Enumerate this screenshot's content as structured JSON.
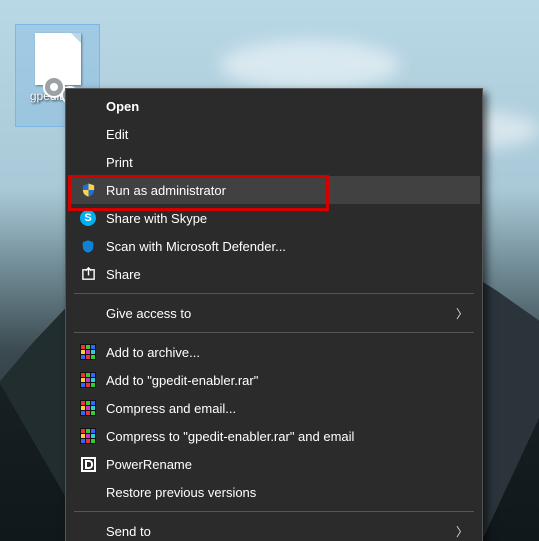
{
  "desktop": {
    "icon": {
      "label": "gpedit-e…",
      "name": "gpedit-enabler"
    }
  },
  "context_menu": {
    "open": "Open",
    "edit": "Edit",
    "print": "Print",
    "run_admin": "Run as administrator",
    "skype": "Share with Skype",
    "defender": "Scan with Microsoft Defender...",
    "share": "Share",
    "give_access": "Give access to",
    "add_archive": "Add to archive...",
    "add_named": "Add to \"gpedit-enabler.rar\"",
    "compress_email": "Compress and email...",
    "compress_named_email": "Compress to \"gpedit-enabler.rar\" and email",
    "powerrename": "PowerRename",
    "restore": "Restore previous versions",
    "send_to": "Send to"
  },
  "highlight_item": "run_admin"
}
